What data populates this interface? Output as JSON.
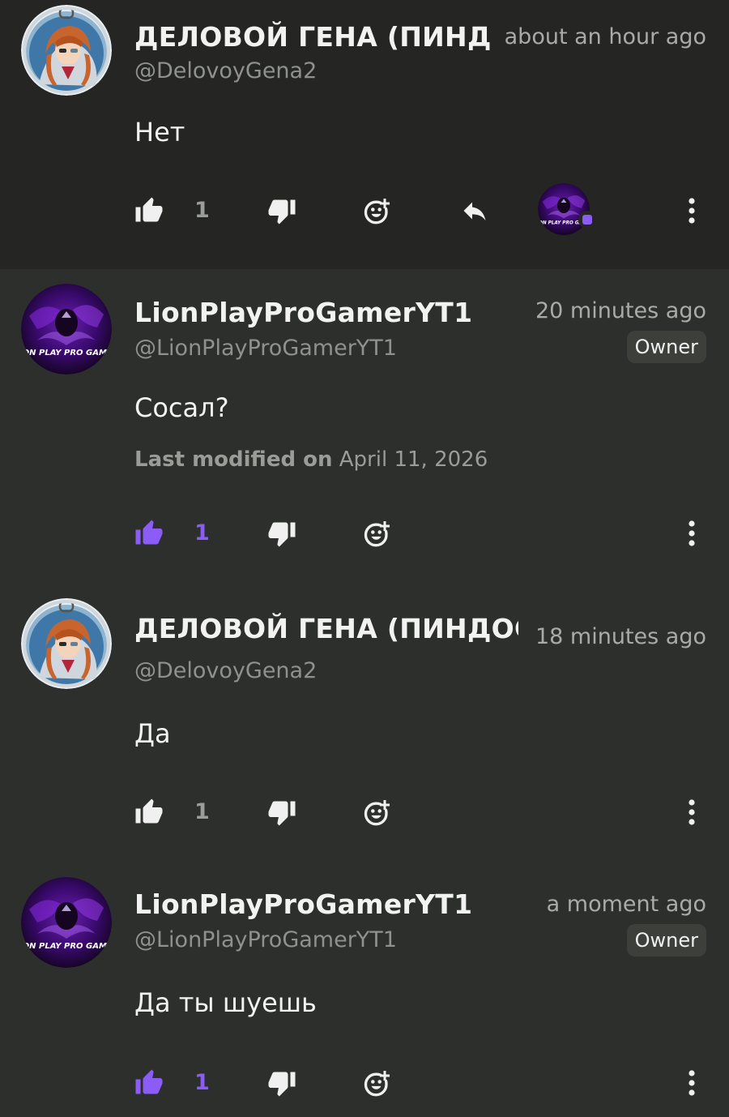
{
  "comments": [
    {
      "name": "ДЕЛОВОЙ ГЕНА (ПИНДОСА",
      "handle": "@DelovoyGena2",
      "time": "about an hour ago",
      "text": "Нет",
      "likes": "1",
      "liked": false
    },
    {
      "name": "LionPlayProGamerYT1",
      "handle": "@LionPlayProGamerYT1",
      "time": "20 minutes ago",
      "badge": "Owner",
      "text": "Сосал?",
      "modified_label": "Last modified on",
      "modified_date": "April 11, 2026",
      "likes": "1",
      "liked": true
    },
    {
      "name": "ДЕЛОВОЙ ГЕНА (ПИНДОСА",
      "handle": "@DelovoyGena2",
      "time": "18 minutes ago",
      "text": "Да",
      "likes": "1",
      "liked": false
    },
    {
      "name": "LionPlayProGamerYT1",
      "handle": "@LionPlayProGamerYT1",
      "time": "a moment ago",
      "badge": "Owner",
      "text": "Да ты шуешь",
      "likes": "1",
      "liked": true
    }
  ],
  "avatar_text": "LION PLAY PRO GAMER",
  "colors": {
    "accent": "#8b5cf6",
    "background": "#2d2f2c",
    "highlight_background": "#252623"
  },
  "icons": [
    "thumbs-up-icon",
    "thumbs-down-icon",
    "add-reaction-icon",
    "reply-icon",
    "more-vert-icon"
  ]
}
